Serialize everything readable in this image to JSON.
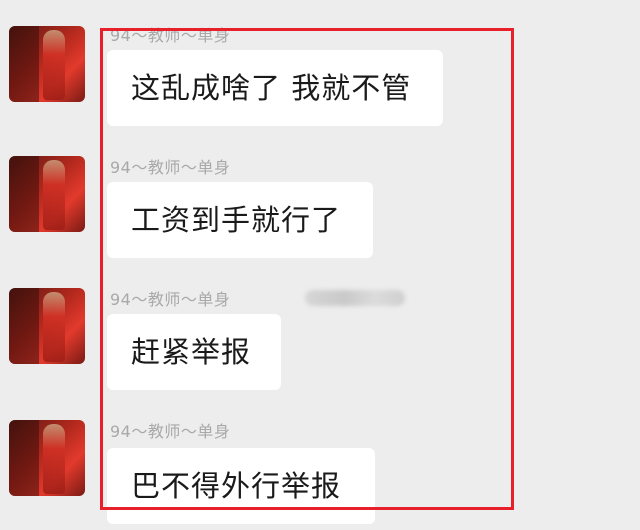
{
  "messages": [
    {
      "sender": "94～教师～单身",
      "text": "这乱成啥了 我就不管"
    },
    {
      "sender": "94～教师～单身",
      "text": "工资到手就行了"
    },
    {
      "sender": "94～教师～单身",
      "text": "赶紧举报"
    },
    {
      "sender": "94～教师～单身",
      "text": "巴不得外行举报"
    }
  ],
  "highlight_color": "#e8202a",
  "avatar_icon": "red-dress-avatar-icon"
}
